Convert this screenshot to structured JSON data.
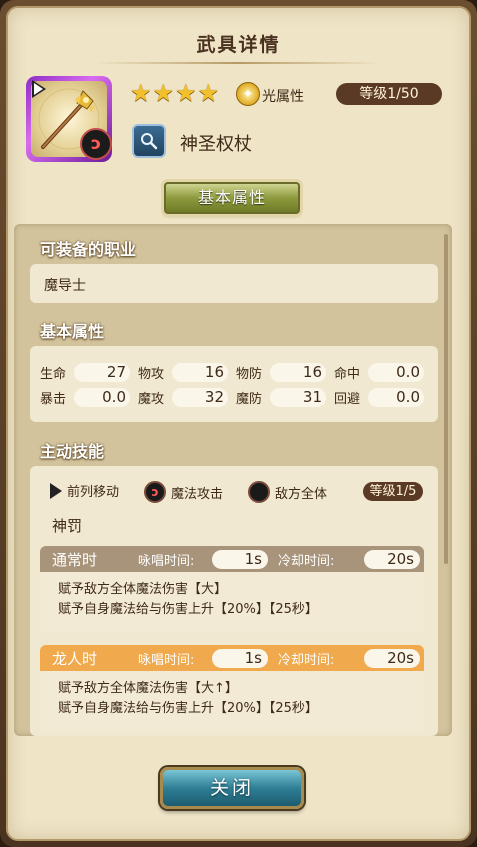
{
  "dialog": {
    "title": "武具详情"
  },
  "weapon": {
    "name": "神圣权杖",
    "stars": [
      "★",
      "★",
      "★",
      "★"
    ],
    "attribute": "光属性",
    "level": "等级1/50",
    "badge_glyph": "ↄ"
  },
  "tab": {
    "label": "基本属性"
  },
  "job": {
    "heading": "可装备的职业",
    "value": "魔导士"
  },
  "stats": {
    "heading": "基本属性",
    "rows": [
      [
        {
          "label": "生命",
          "value": "27"
        },
        {
          "label": "物攻",
          "value": "16"
        },
        {
          "label": "物防",
          "value": "16"
        },
        {
          "label": "命中",
          "value": "0.0"
        }
      ],
      [
        {
          "label": "暴击",
          "value": "0.0"
        },
        {
          "label": "魔攻",
          "value": "32"
        },
        {
          "label": "魔防",
          "value": "31"
        },
        {
          "label": "回避",
          "value": "0.0"
        }
      ]
    ]
  },
  "skill": {
    "heading": "主动技能",
    "move": "前列移动",
    "attack_type": "魔法攻击",
    "target": "敌方全体",
    "level": "等级1/5",
    "name": "神罚",
    "normal": {
      "label": "通常时",
      "cast_label": "咏唱时间:",
      "cast_value": "1s",
      "cd_label": "冷却时间:",
      "cd_value": "20s",
      "desc1": "赋予敌方全体魔法伤害【大】",
      "desc2": "赋予自身魔法给与伤害上升【20%】【25秒】"
    },
    "dragon": {
      "label": "龙人时",
      "cast_label": "咏唱时间:",
      "cast_value": "1s",
      "cd_label": "冷却时间:",
      "cd_value": "20s",
      "desc1": "赋予敌方全体魔法伤害【大↑】",
      "desc2": "赋予自身魔法给与伤害上升【20%】【25秒】"
    }
  },
  "buttons": {
    "close": "关闭"
  },
  "colors": {
    "accent_olive": "#8e9a3d",
    "level_pill": "#5a3a24",
    "dragon_header": "#f0a94c",
    "normal_header": "#a8947a"
  }
}
